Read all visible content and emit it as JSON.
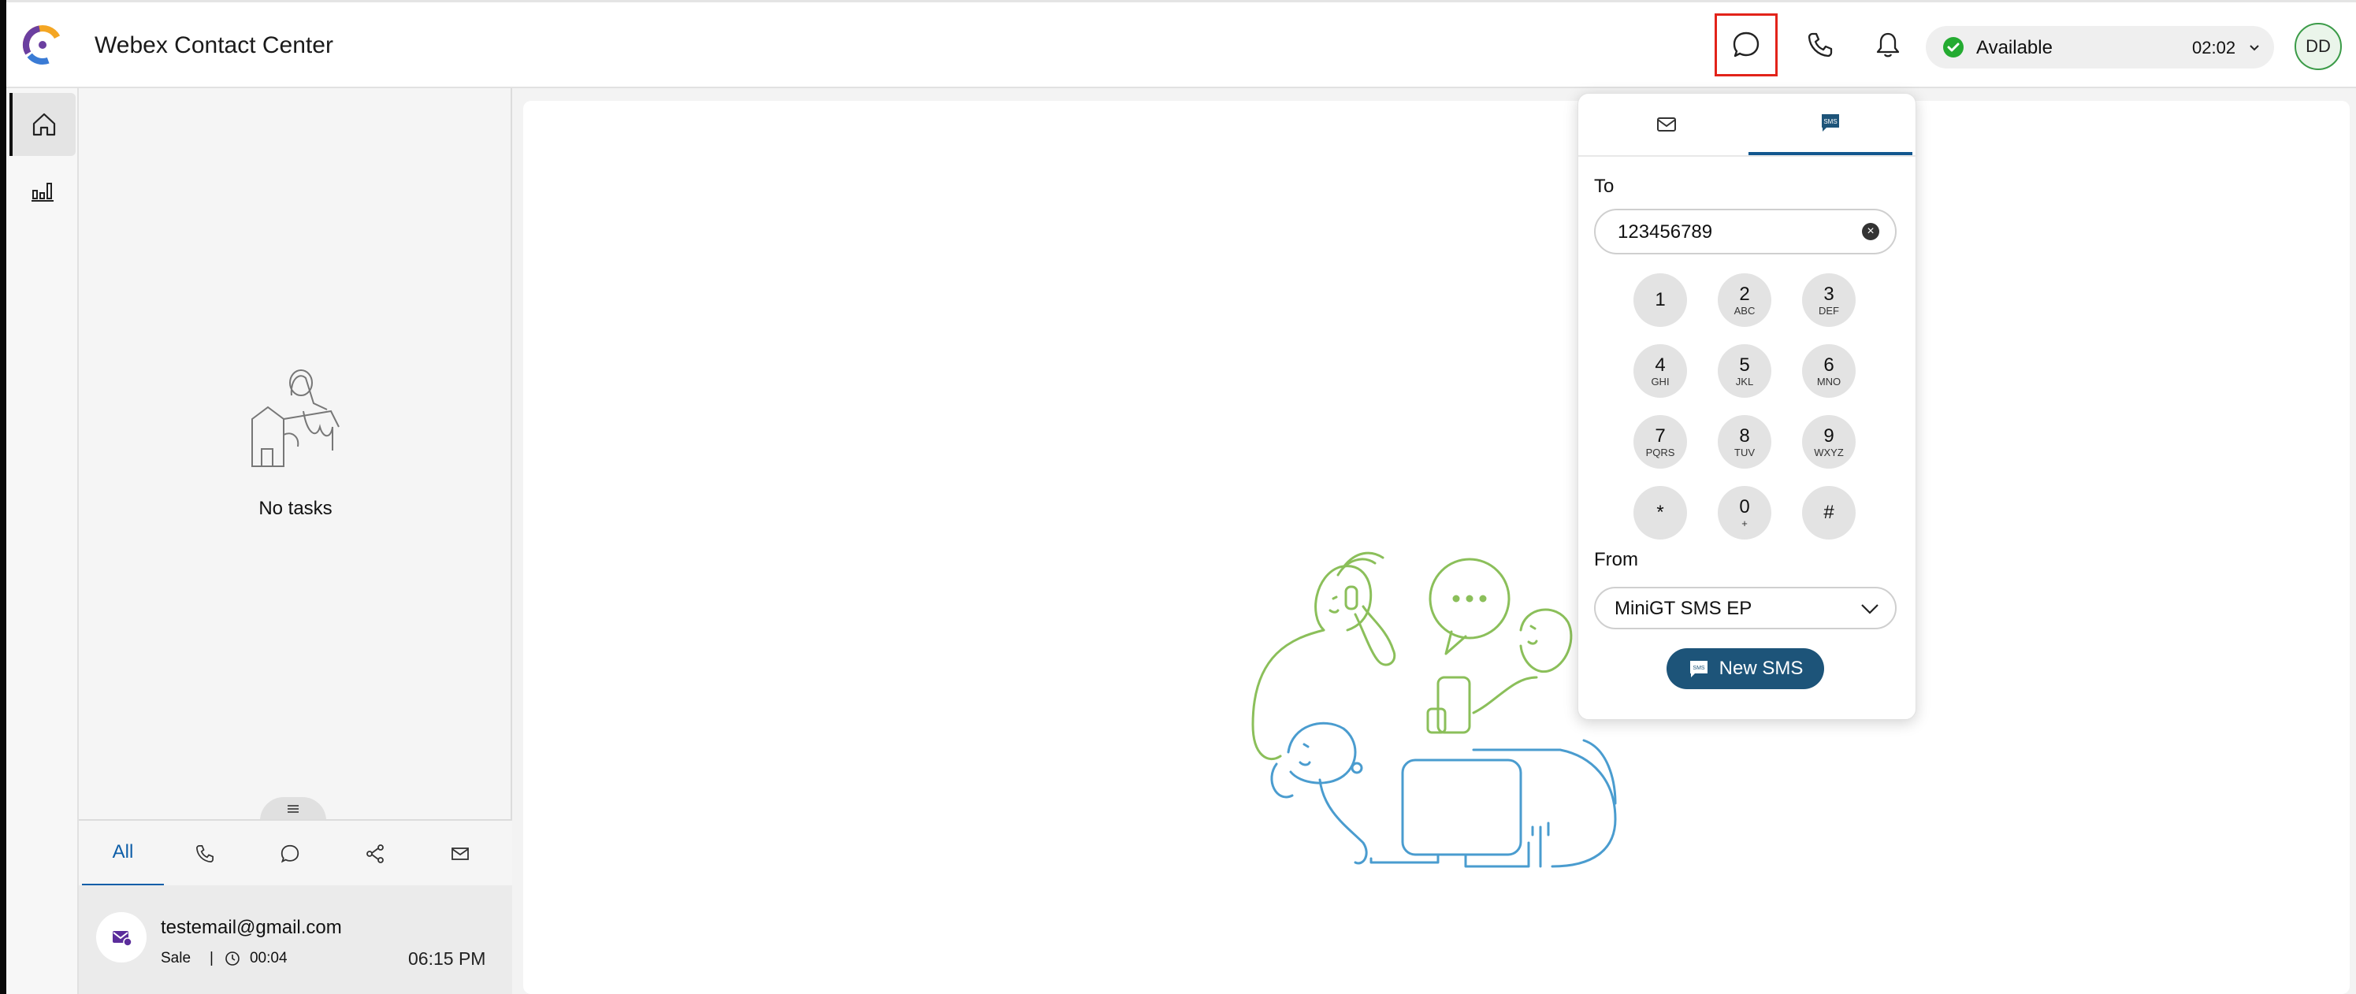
{
  "app": {
    "title": "Webex Contact Center"
  },
  "header": {
    "status": {
      "label": "Available",
      "timer": "02:02",
      "color": "#24ab31"
    },
    "avatar_initials": "DD",
    "icons": [
      "chat-icon",
      "phone-icon",
      "bell-icon"
    ]
  },
  "nav": {
    "items": [
      "home-icon",
      "stats-icon"
    ]
  },
  "tasks": {
    "empty_text": "No tasks",
    "tabs": [
      {
        "label": "All",
        "selected": true
      },
      {
        "label": "",
        "icon": "phone-icon"
      },
      {
        "label": "",
        "icon": "chat-icon"
      },
      {
        "label": "",
        "icon": "share-icon"
      },
      {
        "label": "",
        "icon": "email-icon"
      }
    ],
    "items": [
      {
        "email": "testemail@gmail.com",
        "queue": "Sale",
        "duration": "00:04",
        "time": "06:15 PM"
      }
    ]
  },
  "popup": {
    "tabs": [
      "email-icon",
      "sms-icon"
    ],
    "active_tab": "sms",
    "to_label": "To",
    "to_value": "123456789",
    "keys": [
      {
        "digit": "1",
        "letters": ""
      },
      {
        "digit": "2",
        "letters": "ABC"
      },
      {
        "digit": "3",
        "letters": "DEF"
      },
      {
        "digit": "4",
        "letters": "GHI"
      },
      {
        "digit": "5",
        "letters": "JKL"
      },
      {
        "digit": "6",
        "letters": "MNO"
      },
      {
        "digit": "7",
        "letters": "PQRS"
      },
      {
        "digit": "8",
        "letters": "TUV"
      },
      {
        "digit": "9",
        "letters": "WXYZ"
      },
      {
        "digit": "*",
        "letters": ""
      },
      {
        "digit": "0",
        "letters": "+"
      },
      {
        "digit": "#",
        "letters": ""
      }
    ],
    "from_label": "From",
    "from_value": "MiniGT SMS EP",
    "new_sms_label": "New SMS",
    "sms_badge": "SMS",
    "accent_color": "#1d5479"
  }
}
